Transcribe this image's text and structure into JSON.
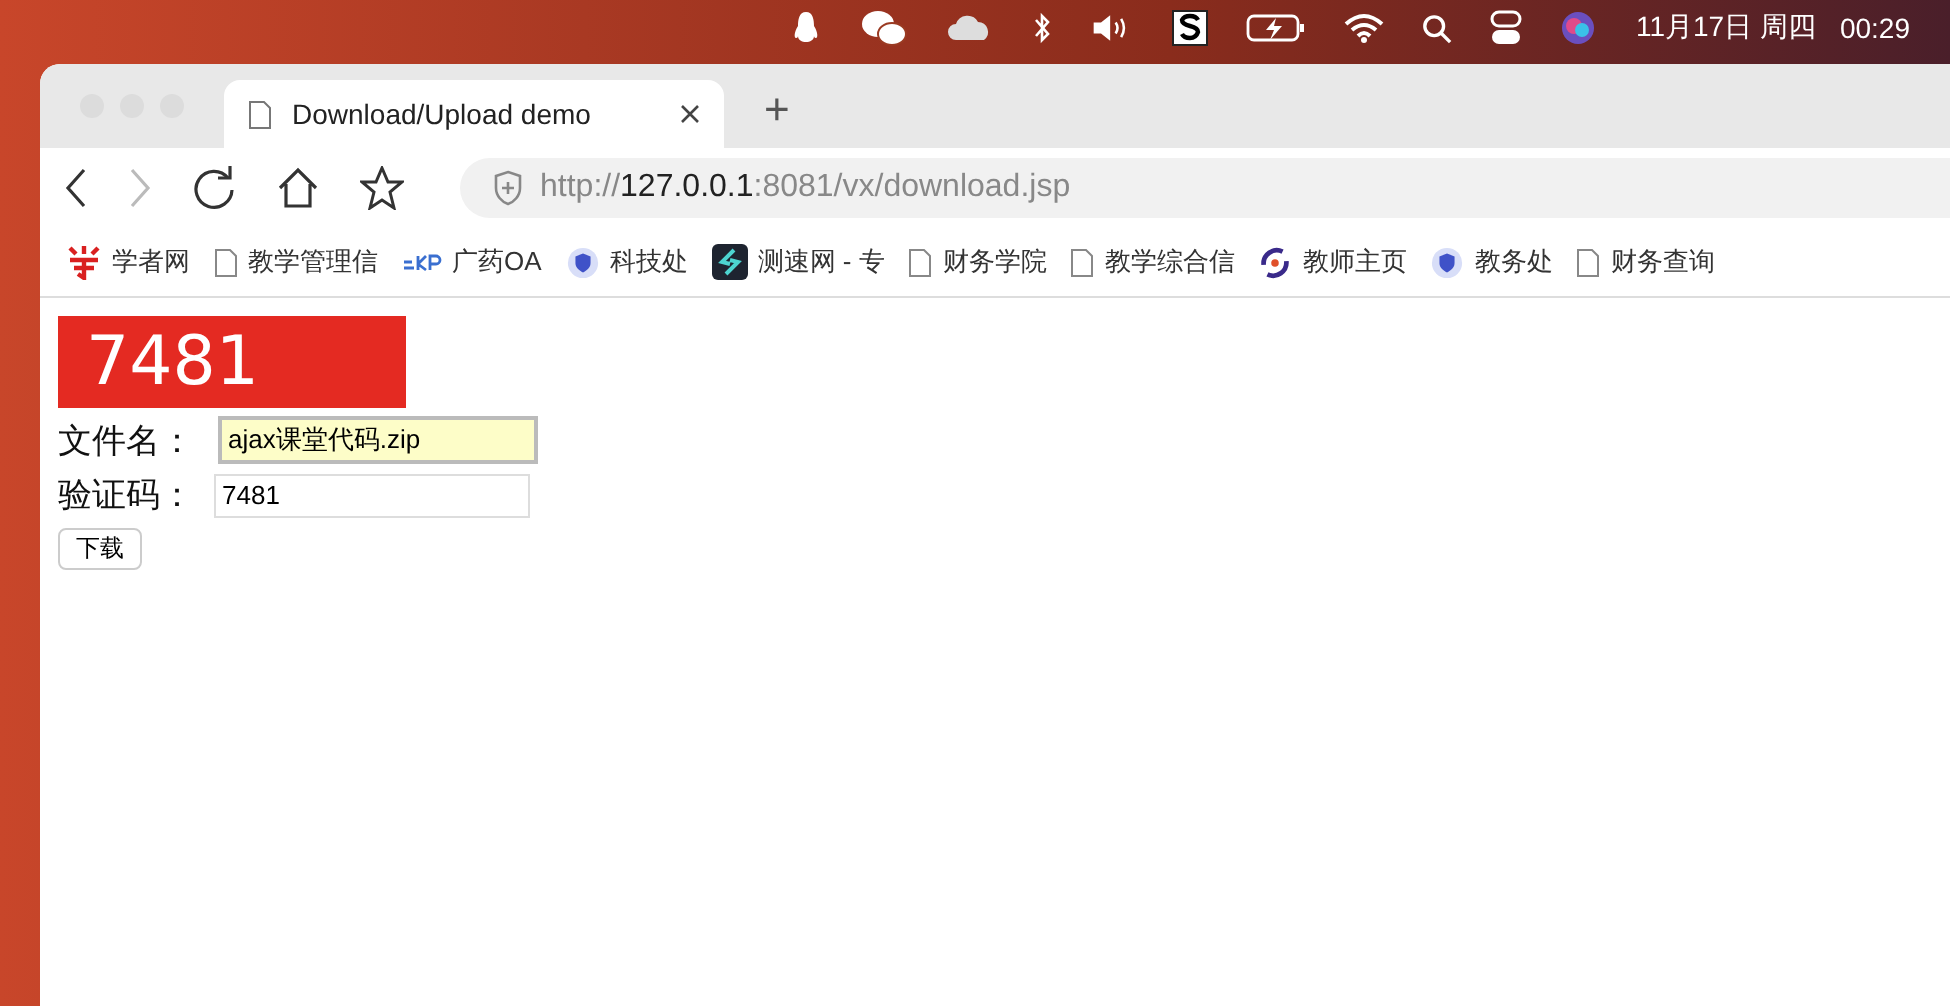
{
  "menu_bar": {
    "date": "11月17日 周四",
    "time": "00:29"
  },
  "tabs": [
    {
      "title": "Download/Upload demo",
      "selected": true
    }
  ],
  "new_tab": "+",
  "address": {
    "scheme": "http://",
    "host": "127.0.0.1",
    "path": ":8081/vx/download.jsp"
  },
  "bookmarks": [
    {
      "label": "学者网",
      "kind": "brand"
    },
    {
      "label": "教学管理信",
      "kind": "page"
    },
    {
      "label": "广药OA",
      "kind": "ekp"
    },
    {
      "label": "科技处",
      "kind": "shield"
    },
    {
      "label": "测速网 - 专",
      "kind": "speed"
    },
    {
      "label": "财务学院",
      "kind": "page"
    },
    {
      "label": "教学综合信",
      "kind": "page"
    },
    {
      "label": "教师主页",
      "kind": "swirl"
    },
    {
      "label": "教务处",
      "kind": "shield"
    },
    {
      "label": "财务查询",
      "kind": "page"
    }
  ],
  "captcha": "7481",
  "form": {
    "fields": [
      {
        "label": "文件名：",
        "value": "ajax课堂代码.zip",
        "autofilled": true
      },
      {
        "label": "验证码：",
        "value": "7481",
        "autofilled": false
      }
    ],
    "button": "下载"
  }
}
